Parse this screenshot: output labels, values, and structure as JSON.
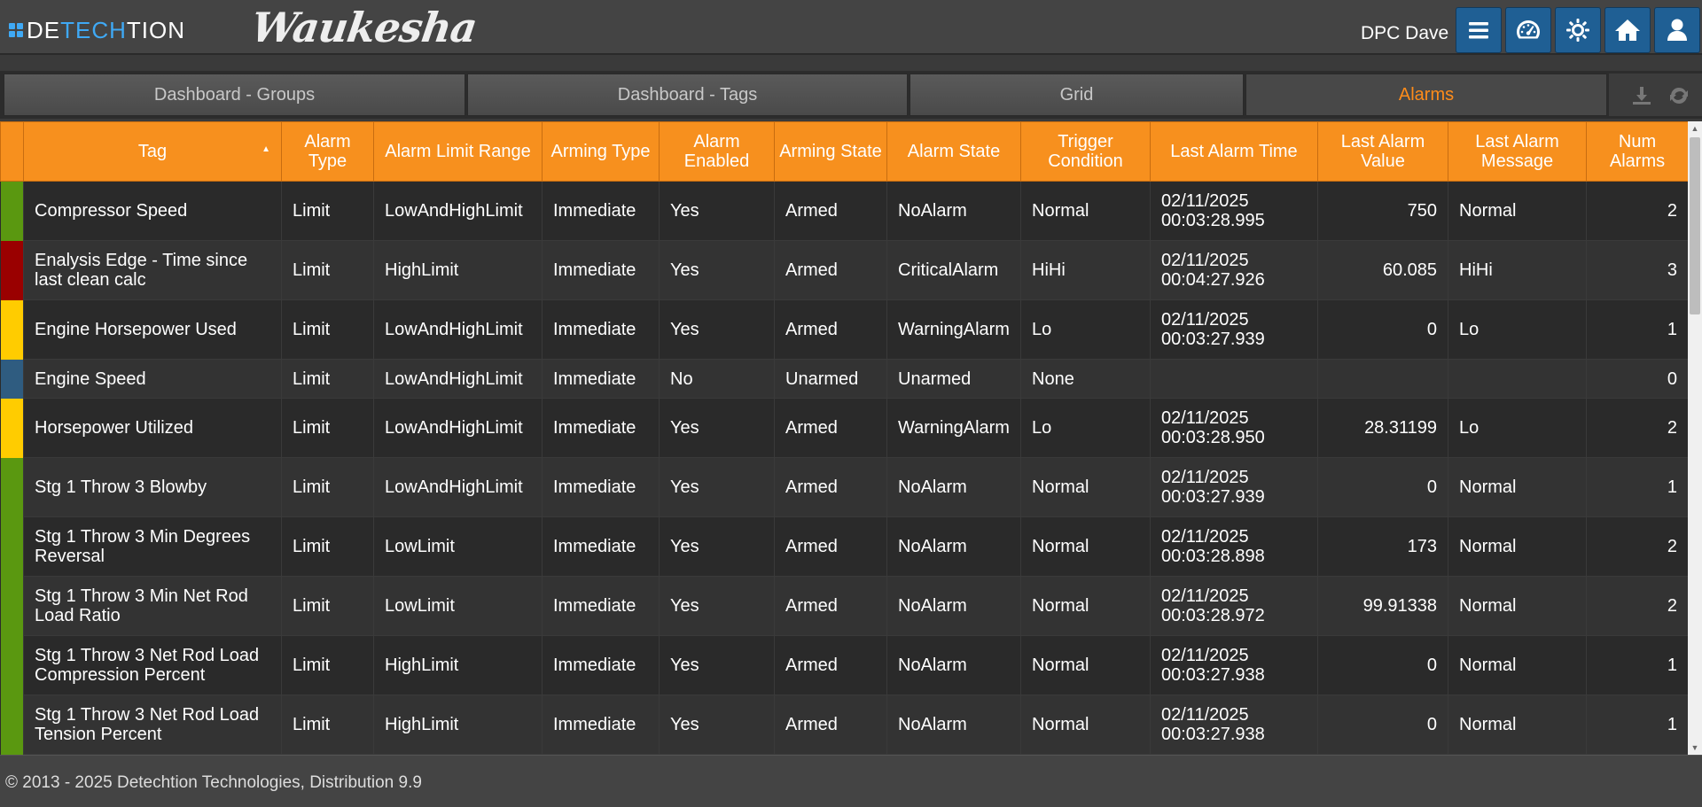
{
  "header": {
    "logo_detechtion": {
      "de": "DE",
      "tech": "TECH",
      "tion": "TION"
    },
    "logo_waukesha": "Waukesha",
    "user_name": "DPC Dave",
    "buttons": [
      "menu-icon",
      "dashboard-gauge-icon",
      "settings-gear-icon",
      "home-icon",
      "user-icon"
    ]
  },
  "tabs": [
    {
      "label": "Dashboard - Groups",
      "active": false
    },
    {
      "label": "Dashboard - Tags",
      "active": false
    },
    {
      "label": "Grid",
      "active": false
    },
    {
      "label": "Alarms",
      "active": true
    }
  ],
  "tab_tools": [
    "download-icon",
    "refresh-icon"
  ],
  "grid": {
    "columns": [
      "Tag",
      "Alarm Type",
      "Alarm Limit Range",
      "Arming Type",
      "Alarm Enabled",
      "Arming State",
      "Alarm State",
      "Trigger Condition",
      "Last Alarm Time",
      "Last Alarm Value",
      "Last Alarm Message",
      "Num Alarms"
    ],
    "sort_column": "Tag",
    "rows": [
      {
        "status": "green",
        "cells": [
          "Compressor Speed",
          "Limit",
          "LowAndHighLimit",
          "Immediate",
          "Yes",
          "Armed",
          "NoAlarm",
          "Normal",
          "02/11/2025 00:03:28.995",
          "750",
          "Normal",
          "2"
        ]
      },
      {
        "status": "red",
        "cells": [
          "Enalysis Edge - Time since last clean calc",
          "Limit",
          "HighLimit",
          "Immediate",
          "Yes",
          "Armed",
          "CriticalAlarm",
          "HiHi",
          "02/11/2025 00:04:27.926",
          "60.085",
          "HiHi",
          "3"
        ]
      },
      {
        "status": "yellow",
        "cells": [
          "Engine Horsepower Used",
          "Limit",
          "LowAndHighLimit",
          "Immediate",
          "Yes",
          "Armed",
          "WarningAlarm",
          "Lo",
          "02/11/2025 00:03:27.939",
          "0",
          "Lo",
          "1"
        ]
      },
      {
        "status": "blue",
        "cells": [
          "Engine Speed",
          "Limit",
          "LowAndHighLimit",
          "Immediate",
          "No",
          "Unarmed",
          "Unarmed",
          "None",
          "",
          "",
          "",
          "0"
        ]
      },
      {
        "status": "yellow",
        "cells": [
          "Horsepower Utilized",
          "Limit",
          "LowAndHighLimit",
          "Immediate",
          "Yes",
          "Armed",
          "WarningAlarm",
          "Lo",
          "02/11/2025 00:03:28.950",
          "28.31199",
          "Lo",
          "2"
        ]
      },
      {
        "status": "green",
        "cells": [
          "Stg 1 Throw 3 Blowby",
          "Limit",
          "LowAndHighLimit",
          "Immediate",
          "Yes",
          "Armed",
          "NoAlarm",
          "Normal",
          "02/11/2025 00:03:27.939",
          "0",
          "Normal",
          "1"
        ]
      },
      {
        "status": "green",
        "cells": [
          "Stg 1 Throw 3 Min Degrees Reversal",
          "Limit",
          "LowLimit",
          "Immediate",
          "Yes",
          "Armed",
          "NoAlarm",
          "Normal",
          "02/11/2025 00:03:28.898",
          "173",
          "Normal",
          "2"
        ]
      },
      {
        "status": "green",
        "cells": [
          "Stg 1 Throw 3 Min Net Rod Load Ratio",
          "Limit",
          "LowLimit",
          "Immediate",
          "Yes",
          "Armed",
          "NoAlarm",
          "Normal",
          "02/11/2025 00:03:28.972",
          "99.91338",
          "Normal",
          "2"
        ]
      },
      {
        "status": "green",
        "cells": [
          "Stg 1 Throw 3 Net Rod Load Compression Percent",
          "Limit",
          "HighLimit",
          "Immediate",
          "Yes",
          "Armed",
          "NoAlarm",
          "Normal",
          "02/11/2025 00:03:27.938",
          "0",
          "Normal",
          "1"
        ]
      },
      {
        "status": "green",
        "cells": [
          "Stg 1 Throw 3 Net Rod Load Tension Percent",
          "Limit",
          "HighLimit",
          "Immediate",
          "Yes",
          "Armed",
          "NoAlarm",
          "Normal",
          "02/11/2025 00:03:27.938",
          "0",
          "Normal",
          "1"
        ]
      }
    ]
  },
  "footer": {
    "text": "© 2013 - 2025 Detechtion Technologies, Distribution 9.9"
  },
  "colors": {
    "accent_orange": "#f7901e",
    "status_green": "#5a9810",
    "status_red": "#9a0000",
    "status_yellow": "#ffcc00",
    "status_blue": "#2f5c80",
    "button_blue": "#1f5f94"
  }
}
